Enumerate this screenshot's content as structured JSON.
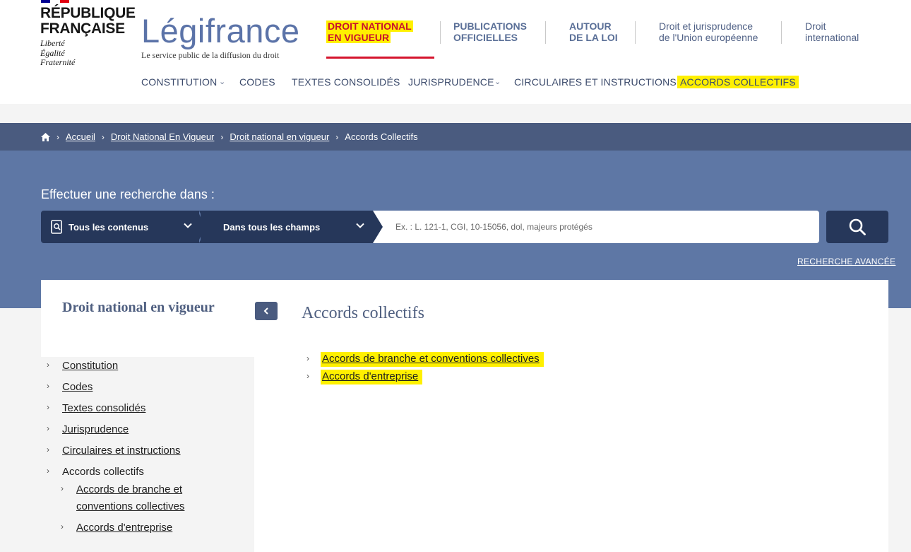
{
  "header": {
    "republique": [
      "RÉPUBLIQUE",
      "FRANÇAISE"
    ],
    "devise": [
      "Liberté",
      "Égalité",
      "Fraternité"
    ],
    "brand_name": "Légifrance",
    "brand_tagline": "Le service public de la diffusion du droit",
    "topnav": [
      {
        "line1": "DROIT NATIONAL",
        "line2": "EN VIGUEUR",
        "active": true
      },
      {
        "line1": "PUBLICATIONS",
        "line2": "OFFICIELLES"
      },
      {
        "line1": "AUTOUR",
        "line2": "DE LA LOI"
      },
      {
        "line1": "Droit et jurisprudence",
        "line2": "de l'Union européenne"
      },
      {
        "line1": "Droit",
        "line2": "international"
      }
    ],
    "subnav": [
      {
        "label": "CONSTITUTION",
        "has_dropdown": true
      },
      {
        "label": "CODES"
      },
      {
        "label": "TEXTES CONSOLIDÉS"
      },
      {
        "label": "JURISPRUDENCE",
        "has_dropdown": true
      },
      {
        "label": "CIRCULAIRES ET INSTRUCTIONS"
      },
      {
        "label": "ACCORDS COLLECTIFS",
        "has_dropdown": true,
        "highlighted": true
      }
    ],
    "colors": {
      "brand": "#5b73a8",
      "active_red": "#d5142d",
      "highlight": "#fff000"
    }
  },
  "breadcrumb": {
    "items": [
      "Accueil",
      "Droit National En Vigueur",
      "Droit national en vigueur"
    ],
    "current": "Accords Collectifs"
  },
  "search": {
    "title": "Effectuer une recherche dans :",
    "scope": "Tous les contenus",
    "field": "Dans tous les champs",
    "placeholder": "Ex. : L. 121-1, CGI, 10-15056, dol, majeurs protégés",
    "advanced": "RECHERCHE AVANCÉE"
  },
  "sidebar": {
    "title": "Droit national en vigueur",
    "items": [
      "Constitution",
      "Codes",
      "Textes consolidés",
      "Jurisprudence",
      "Circulaires et instructions",
      "Accords collectifs"
    ],
    "subitems": [
      "Accords de branche et conventions collectives",
      "Accords d'entreprise"
    ],
    "subitem1_lines": [
      "Accords de branche et",
      "conventions collectives"
    ]
  },
  "main": {
    "title": "Accords collectifs",
    "links": [
      "Accords de branche et conventions collectives",
      "Accords d'entreprise"
    ]
  }
}
